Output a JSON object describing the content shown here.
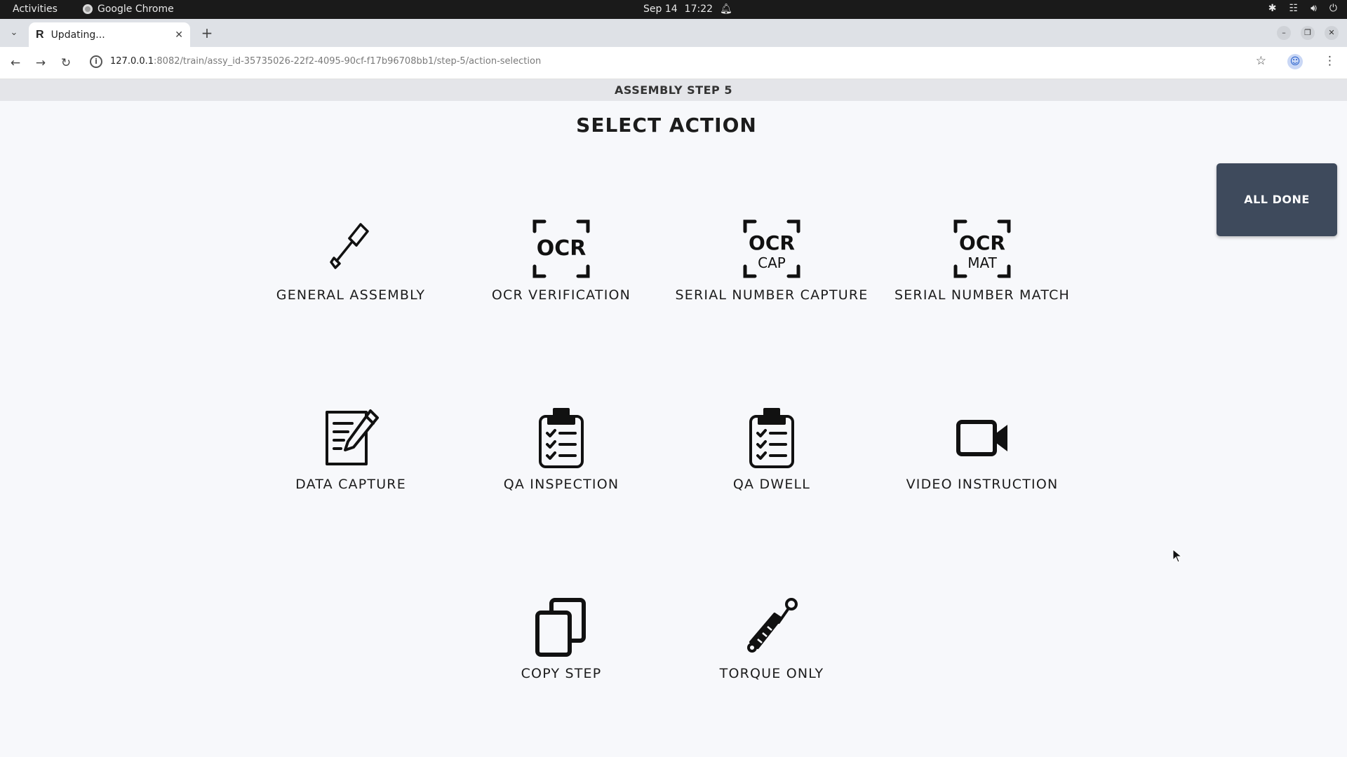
{
  "system_bar": {
    "activities": "Activities",
    "app_name": "Google Chrome",
    "date": "Sep 14",
    "time": "17:22"
  },
  "browser": {
    "tab_title": "Updating...",
    "tab_favicon": "R",
    "url_host": "127.0.0.1",
    "url_rest": ":8082/train/assy_id-35735026-22f2-4095-90cf-f17b96708bb1/step-5/action-selection"
  },
  "page": {
    "step_header": "ASSEMBLY STEP 5",
    "title": "SELECT ACTION",
    "all_done_label": "ALL DONE"
  },
  "actions": [
    {
      "label": "GENERAL ASSEMBLY",
      "icon": "screwdriver-icon"
    },
    {
      "label": "OCR VERIFICATION",
      "icon": "ocr-icon",
      "icon_text": "OCR"
    },
    {
      "label": "SERIAL NUMBER CAPTURE",
      "icon": "ocr-cap-icon",
      "icon_text": "OCR",
      "icon_subtext": "CAP"
    },
    {
      "label": "SERIAL NUMBER MATCH",
      "icon": "ocr-mat-icon",
      "icon_text": "OCR",
      "icon_subtext": "MAT"
    },
    {
      "label": "DATA CAPTURE",
      "icon": "edit-document-icon"
    },
    {
      "label": "QA INSPECTION",
      "icon": "clipboard-checklist-icon"
    },
    {
      "label": "QA DWELL",
      "icon": "clipboard-checklist-icon"
    },
    {
      "label": "VIDEO INSTRUCTION",
      "icon": "video-camera-icon"
    },
    {
      "label": "COPY STEP",
      "icon": "copy-icon"
    },
    {
      "label": "TORQUE ONLY",
      "icon": "torque-wrench-icon"
    }
  ],
  "colors": {
    "all_done_bg": "#3e4a5c",
    "page_bg": "#f7f8fb",
    "step_bar_bg": "#e4e5e9"
  }
}
